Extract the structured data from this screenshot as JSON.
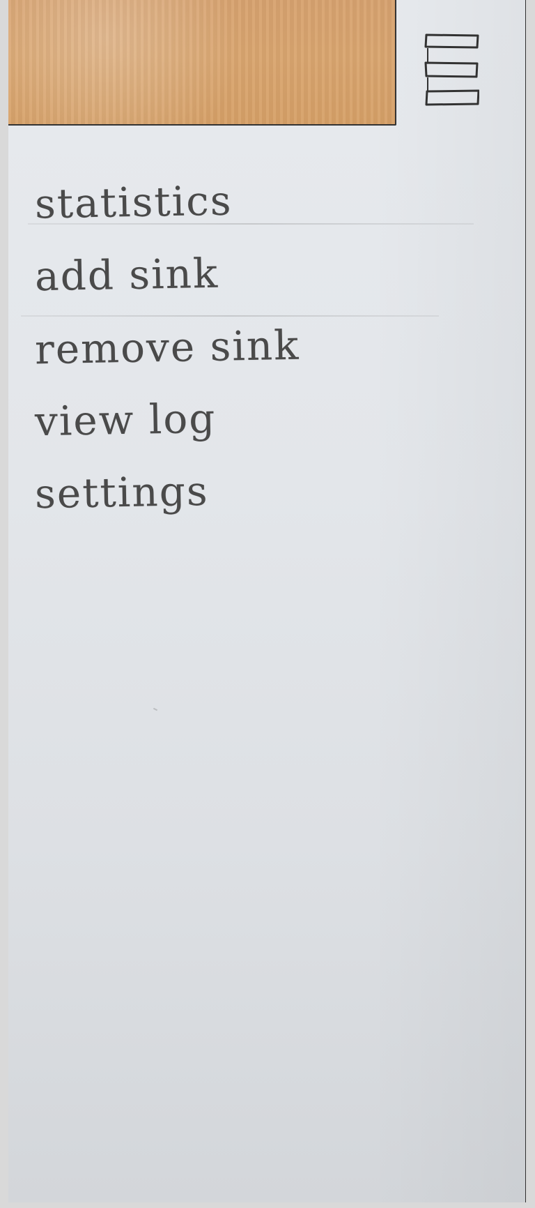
{
  "menu": {
    "items": [
      {
        "label": "statistics"
      },
      {
        "label": "add sink"
      },
      {
        "label": "remove sink"
      },
      {
        "label": "view log"
      },
      {
        "label": "settings"
      }
    ]
  },
  "icons": {
    "menu_button": "hamburger-icon"
  },
  "colors": {
    "header": "#d9a56f",
    "paper": "#e5e8ec",
    "ink": "#4a4a4a"
  }
}
